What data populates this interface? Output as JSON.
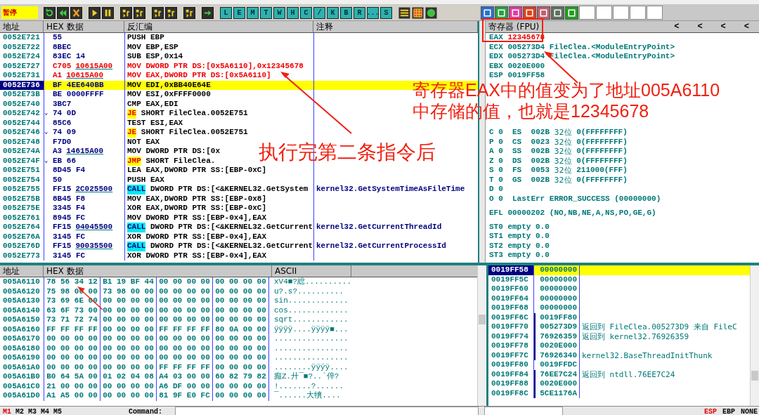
{
  "status": "暂停",
  "letter_buttons": [
    "L",
    "E",
    "M",
    "T",
    "W",
    "H",
    "C",
    "/",
    "K",
    "B",
    "R",
    "...",
    "S"
  ],
  "disassembly": {
    "columns": [
      "地址",
      "HEX 数据",
      "反汇编",
      "注释"
    ],
    "rows": [
      {
        "address": "0052E721",
        "hex": "55",
        "mnemonic": "PUSH",
        "operands": "EBP",
        "kind": "plain",
        "selected": false
      },
      {
        "address": "0052E722",
        "hex": "8BEC",
        "mnemonic": "MOV",
        "operands": "EBP,ESP",
        "kind": "plain",
        "selected": false
      },
      {
        "address": "0052E724",
        "hex": "83EC 14",
        "mnemonic": "SUB",
        "operands": "ESP,0x14",
        "kind": "plain",
        "selected": false
      },
      {
        "address": "0052E727",
        "hex": "C705",
        "hex_ref": "10615A00",
        "mnemonic": "MOV",
        "operands": "DWORD PTR DS:[0x5A6110],0x12345678",
        "kind": "changed",
        "selected": false
      },
      {
        "address": "0052E731",
        "hex": "A1",
        "hex_ref": "10615A00",
        "mnemonic": "MOV",
        "operands": "EAX,DWORD PTR DS:[0x5A6110]",
        "kind": "changed",
        "selected": false
      },
      {
        "address": "0052E736",
        "hex": "BF 4EE640BB",
        "mnemonic": "MOV",
        "operands": "EDI,0xBB40E64E",
        "kind": "plain",
        "selected": true
      },
      {
        "address": "0052E73B",
        "hex": "BE 0000FFFF",
        "mnemonic": "MOV",
        "operands": "ESI,0xFFFF0000",
        "kind": "plain",
        "selected": false
      },
      {
        "address": "0052E740",
        "hex": "3BC7",
        "mnemonic": "CMP",
        "operands": "EAX,EDI",
        "kind": "plain",
        "selected": false
      },
      {
        "address": "0052E742",
        "mark": "⌄",
        "hex": "74 0D",
        "mnemonic": "JE",
        "operands": "SHORT FileClea.0052E751",
        "kind": "jump",
        "selected": false
      },
      {
        "address": "0052E744",
        "hex": "85C6",
        "mnemonic": "TEST",
        "operands": "ESI,EAX",
        "kind": "plain",
        "selected": false
      },
      {
        "address": "0052E746",
        "mark": "⌄",
        "hex": "74 09",
        "mnemonic": "JE",
        "operands": "SHORT FileClea.0052E751",
        "kind": "jump",
        "selected": false
      },
      {
        "address": "0052E748",
        "hex": "F7D0",
        "mnemonic": "NOT",
        "operands": "EAX",
        "kind": "plain",
        "selected": false
      },
      {
        "address": "0052E74A",
        "hex": "A3",
        "hex_ref": "14615A00",
        "mnemonic": "MOV",
        "operands": "DWORD PTR DS:[0x",
        "kind": "plain",
        "selected": false
      },
      {
        "address": "0052E74F",
        "mark": "⌄",
        "hex": "EB 66",
        "mnemonic": "JMP",
        "operands": "SHORT FileClea.",
        "kind": "jump",
        "selected": false
      },
      {
        "address": "0052E751",
        "hex": "8D45 F4",
        "mnemonic": "LEA",
        "operands": "EAX,DWORD PTR SS:[EBP-0xC]",
        "kind": "plain",
        "selected": false
      },
      {
        "address": "0052E754",
        "hex": "50",
        "mnemonic": "PUSH",
        "operands": "EAX",
        "kind": "plain",
        "selected": false
      },
      {
        "address": "0052E755",
        "hex": "FF15",
        "hex_ref": "2C025500",
        "mnemonic": "CALL",
        "operands": "DWORD PTR DS:[<&KERNEL32.GetSystem",
        "comment": "kernel32.GetSystemTimeAsFileTime",
        "kind": "call",
        "selected": false
      },
      {
        "address": "0052E75B",
        "hex": "8B45 F8",
        "mnemonic": "MOV",
        "operands": "EAX,DWORD PTR SS:[EBP-0x8]",
        "kind": "plain",
        "selected": false
      },
      {
        "address": "0052E75E",
        "hex": "3345 F4",
        "mnemonic": "XOR",
        "operands": "EAX,DWORD PTR SS:[EBP-0xC]",
        "kind": "plain",
        "selected": false
      },
      {
        "address": "0052E761",
        "hex": "8945 FC",
        "mnemonic": "MOV",
        "operands": "DWORD PTR SS:[EBP-0x4],EAX",
        "kind": "plain",
        "selected": false
      },
      {
        "address": "0052E764",
        "hex": "FF15",
        "hex_ref": "04045500",
        "mnemonic": "CALL",
        "operands": "DWORD PTR DS:[<&KERNEL32.GetCurrent",
        "comment": "kernel32.GetCurrentThreadId",
        "kind": "call",
        "selected": false
      },
      {
        "address": "0052E76A",
        "hex": "3145 FC",
        "mnemonic": "XOR",
        "operands": "DWORD PTR SS:[EBP-0x4],EAX",
        "kind": "plain",
        "selected": false
      },
      {
        "address": "0052E76D",
        "hex": "FF15",
        "hex_ref": "90035500",
        "mnemonic": "CALL",
        "operands": "DWORD PTR DS:[<&KERNEL32.GetCurrent",
        "comment": "kernel32.GetCurrentProcessId",
        "kind": "call",
        "selected": false
      },
      {
        "address": "0052E773",
        "hex": "3145 FC",
        "mnemonic": "XOR",
        "operands": "DWORD PTR SS:[EBP-0x4],EAX",
        "kind": "plain",
        "selected": false
      }
    ]
  },
  "registers": {
    "title": "寄存器 (FPU)",
    "nav": [
      "<",
      "<",
      "<",
      "<"
    ],
    "general": [
      {
        "name": "EAX",
        "value": "12345678",
        "changed": true
      },
      {
        "name": "ECX",
        "value": "005273D4",
        "note": "FileClea.<ModuleEntryPoint>",
        "changed": false
      },
      {
        "name": "EDX",
        "value": "005273D4",
        "note": "FileClea.<ModuleEntryPoint>",
        "changed": false
      },
      {
        "name": "EBX",
        "value": "0020E000",
        "changed": false
      },
      {
        "name": "ESP",
        "value": "0019FF58",
        "changed": false
      }
    ],
    "flags": [
      {
        "flag": "C",
        "value": "0",
        "segment": "ES",
        "selector": "002B",
        "width": "32位",
        "limit": "0(FFFFFFFF)"
      },
      {
        "flag": "P",
        "value": "0",
        "segment": "CS",
        "selector": "0023",
        "width": "32位",
        "limit": "0(FFFFFFFF)"
      },
      {
        "flag": "A",
        "value": "0",
        "segment": "SS",
        "selector": "002B",
        "width": "32位",
        "limit": "0(FFFFFFFF)"
      },
      {
        "flag": "Z",
        "value": "0",
        "segment": "DS",
        "selector": "002B",
        "width": "32位",
        "limit": "0(FFFFFFFF)"
      },
      {
        "flag": "S",
        "value": "0",
        "segment": "FS",
        "selector": "0053",
        "width": "32位",
        "limit": "211000(FFF)"
      },
      {
        "flag": "T",
        "value": "0",
        "segment": "GS",
        "selector": "002B",
        "width": "32位",
        "limit": "0(FFFFFFFF)"
      },
      {
        "flag": "D",
        "value": "0"
      },
      {
        "flag": "O",
        "value": "0",
        "note": "LastErr ERROR_SUCCESS (00000000)"
      }
    ],
    "efl": {
      "name": "EFL",
      "value": "00000202",
      "note": "(NO,NB,NE,A,NS,PO,GE,G)"
    },
    "fpu": [
      {
        "name": "ST0",
        "value": "empty 0.0"
      },
      {
        "name": "ST1",
        "value": "empty 0.0"
      },
      {
        "name": "ST2",
        "value": "empty 0.0"
      },
      {
        "name": "ST3",
        "value": "empty 0.0"
      }
    ]
  },
  "dump": {
    "columns": [
      "地址",
      "HEX 数据",
      "ASCII"
    ],
    "rows": [
      {
        "address": "005A6110",
        "bytes": [
          "78",
          "56",
          "34",
          "12",
          "B1",
          "19",
          "BF",
          "44",
          "00",
          "00",
          "00",
          "00",
          "00",
          "00",
          "00",
          "00"
        ],
        "ascii": "xV4■?総.........."
      },
      {
        "address": "005A6120",
        "bytes": [
          "75",
          "98",
          "00",
          "00",
          "73",
          "98",
          "00",
          "00",
          "00",
          "00",
          "00",
          "00",
          "00",
          "00",
          "00",
          "00"
        ],
        "ascii": "u?.s?.........."
      },
      {
        "address": "005A6130",
        "bytes": [
          "73",
          "69",
          "6E",
          "00",
          "00",
          "00",
          "00",
          "00",
          "00",
          "00",
          "00",
          "00",
          "00",
          "00",
          "00",
          "00"
        ],
        "ascii": "sin............."
      },
      {
        "address": "005A6140",
        "bytes": [
          "63",
          "6F",
          "73",
          "00",
          "00",
          "00",
          "00",
          "00",
          "00",
          "00",
          "00",
          "00",
          "00",
          "00",
          "00",
          "00"
        ],
        "ascii": "cos............."
      },
      {
        "address": "005A6150",
        "bytes": [
          "73",
          "71",
          "72",
          "74",
          "00",
          "00",
          "00",
          "00",
          "00",
          "00",
          "00",
          "00",
          "00",
          "00",
          "00",
          "00"
        ],
        "ascii": "sqrt............"
      },
      {
        "address": "005A6160",
        "bytes": [
          "FF",
          "FF",
          "FF",
          "FF",
          "00",
          "00",
          "00",
          "00",
          "FF",
          "FF",
          "FF",
          "FF",
          "80",
          "0A",
          "00",
          "00"
        ],
        "ascii": "ÿÿÿÿ....ÿÿÿÿ■..."
      },
      {
        "address": "005A6170",
        "bytes": [
          "00",
          "00",
          "00",
          "00",
          "00",
          "00",
          "00",
          "00",
          "00",
          "00",
          "00",
          "00",
          "00",
          "00",
          "00",
          "00"
        ],
        "ascii": "................"
      },
      {
        "address": "005A6180",
        "bytes": [
          "00",
          "00",
          "00",
          "00",
          "00",
          "00",
          "00",
          "00",
          "00",
          "00",
          "00",
          "00",
          "00",
          "00",
          "00",
          "00"
        ],
        "ascii": "................"
      },
      {
        "address": "005A6190",
        "bytes": [
          "00",
          "00",
          "00",
          "00",
          "00",
          "00",
          "00",
          "00",
          "00",
          "00",
          "00",
          "00",
          "00",
          "00",
          "00",
          "00"
        ],
        "ascii": "................"
      },
      {
        "address": "005A61A0",
        "bytes": [
          "00",
          "00",
          "00",
          "00",
          "00",
          "00",
          "00",
          "00",
          "FF",
          "FF",
          "FF",
          "FF",
          "00",
          "00",
          "00",
          "00"
        ],
        "ascii": "........ÿÿÿÿ...."
      },
      {
        "address": "005A61B0",
        "bytes": [
          "B0",
          "64",
          "5A",
          "00",
          "01",
          "02",
          "04",
          "08",
          "A4",
          "03",
          "00",
          "00",
          "60",
          "82",
          "79",
          "82"
        ],
        "ascii": "癲Z.廾¯■?..`倅?"
      },
      {
        "address": "005A61C0",
        "bytes": [
          "21",
          "00",
          "00",
          "00",
          "00",
          "00",
          "00",
          "00",
          "A6",
          "DF",
          "00",
          "00",
          "00",
          "00",
          "00",
          "00"
        ],
        "ascii": "!.......?......"
      },
      {
        "address": "005A61D0",
        "bytes": [
          "A1",
          "A5",
          "00",
          "00",
          "00",
          "00",
          "00",
          "00",
          "81",
          "9F",
          "E0",
          "FC",
          "00",
          "00",
          "00",
          "00"
        ],
        "ascii": "¯......大犢...."
      }
    ]
  },
  "stack": {
    "rows": [
      {
        "address": "0019FF58",
        "value": "00000000",
        "in_frame": false,
        "selected": true
      },
      {
        "address": "0019FF5C",
        "value": "00000000",
        "in_frame": false,
        "selected": false
      },
      {
        "address": "0019FF60",
        "value": "00000000",
        "in_frame": false,
        "selected": false
      },
      {
        "address": "0019FF64",
        "value": "00000000",
        "in_frame": false,
        "selected": false
      },
      {
        "address": "0019FF68",
        "value": "00000000",
        "in_frame": false,
        "selected": false
      },
      {
        "address": "0019FF6C",
        "value": "0019FF80",
        "in_frame": true,
        "selected": false
      },
      {
        "address": "0019FF70",
        "value": "005273D9",
        "comment": "返回到 FileClea.005273D9 来自 FileC",
        "in_frame": true,
        "selected": false
      },
      {
        "address": "0019FF74",
        "value": "76926359",
        "comment": "返回到 kernel32.76926359",
        "in_frame": true,
        "selected": false
      },
      {
        "address": "0019FF78",
        "value": "0020E000",
        "in_frame": true,
        "selected": false
      },
      {
        "address": "0019FF7C",
        "value": "76926340",
        "comment": "kernel32.BaseThreadInitThunk",
        "in_frame": true,
        "selected": false
      },
      {
        "address": "0019FF80",
        "value": "0019FFDC",
        "in_frame": false,
        "selected": false
      },
      {
        "address": "0019FF84",
        "value": "76EE7C24",
        "comment": "返回到 ntdll.76EE7C24",
        "in_frame": true,
        "selected": false
      },
      {
        "address": "0019FF88",
        "value": "0020E000",
        "in_frame": true,
        "selected": false
      },
      {
        "address": "0019FF8C",
        "value": "5CE1176A",
        "in_frame": true,
        "selected": false
      }
    ]
  },
  "bottom": {
    "memory_tabs": [
      {
        "label": "M1",
        "selected": true
      },
      {
        "label": "M2",
        "selected": false
      },
      {
        "label": "M3",
        "selected": false
      },
      {
        "label": "M4",
        "selected": false
      },
      {
        "label": "M5",
        "selected": false
      }
    ],
    "command_label": "Command:",
    "indicators": [
      {
        "label": "ESP",
        "selected": true
      },
      {
        "label": "EBP",
        "selected": false
      },
      {
        "label": "NONE",
        "selected": false
      }
    ]
  },
  "annotations": {
    "register_note": [
      "寄存器EAX中的值变为了地址005A6110",
      "中存储的值，也就是12345678"
    ],
    "step_note": "执行完第二条指令后"
  }
}
